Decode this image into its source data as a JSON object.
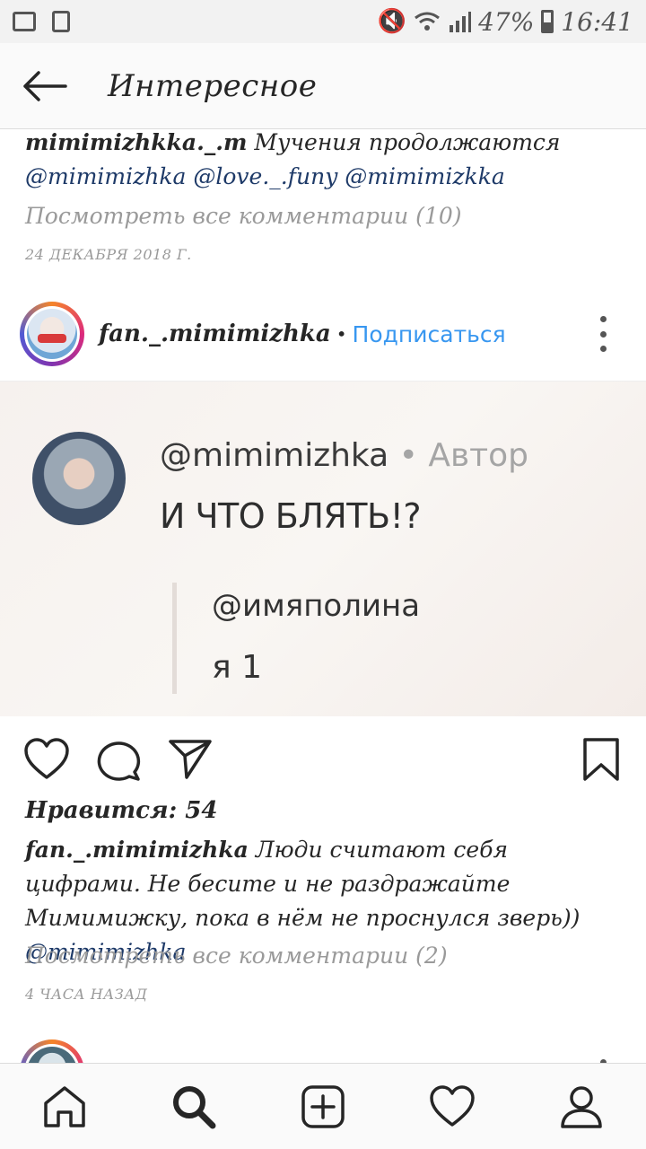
{
  "status_bar": {
    "battery": "47%",
    "time": "16:41"
  },
  "header": {
    "title": "Интересное"
  },
  "previous_post": {
    "caption_user": "mimimizhkka._.m",
    "caption_text": " Мучения продолжаются",
    "caption_mentions": "@mimimizhka @love._.funy @mimimizkka",
    "view_comments": "Посмотреть все комментарии (10)",
    "date": "24 ДЕКАБРЯ 2018 Г."
  },
  "post": {
    "username": "fan._.mimimizhka",
    "separator": "•",
    "follow_label": "Подписаться",
    "image": {
      "handle": "@mimimizhka",
      "separator": " • ",
      "author_label": "Автор",
      "comment_text": "И ЧТО БЛЯТЬ!?",
      "reply_user": "@имяполина",
      "reply_text": "я 1"
    },
    "likes": "Нравится: 54",
    "caption_user": "fan._.mimimizhka",
    "caption_text": " Люди считают себя цифрами. Не бесите и не раздражайте Мимимижку, пока в нём не проснулся зверь)) ",
    "caption_mention": "@mimimizhka",
    "view_comments": "Посмотреть все комментарии (2)",
    "time_ago": "4 ЧАСА НАЗАД"
  },
  "icons": {
    "back": "arrow-left-icon",
    "more": "more-vertical-icon",
    "like": "heart-icon",
    "comment": "comment-icon",
    "share": "send-icon",
    "save": "bookmark-icon",
    "nav_home": "home-icon",
    "nav_search": "search-icon",
    "nav_add": "add-post-icon",
    "nav_activity": "heart-icon",
    "nav_profile": "profile-icon"
  },
  "colors": {
    "link_blue": "#3897f0",
    "mention": "#1e3a68",
    "muted": "#9a9a9a"
  }
}
